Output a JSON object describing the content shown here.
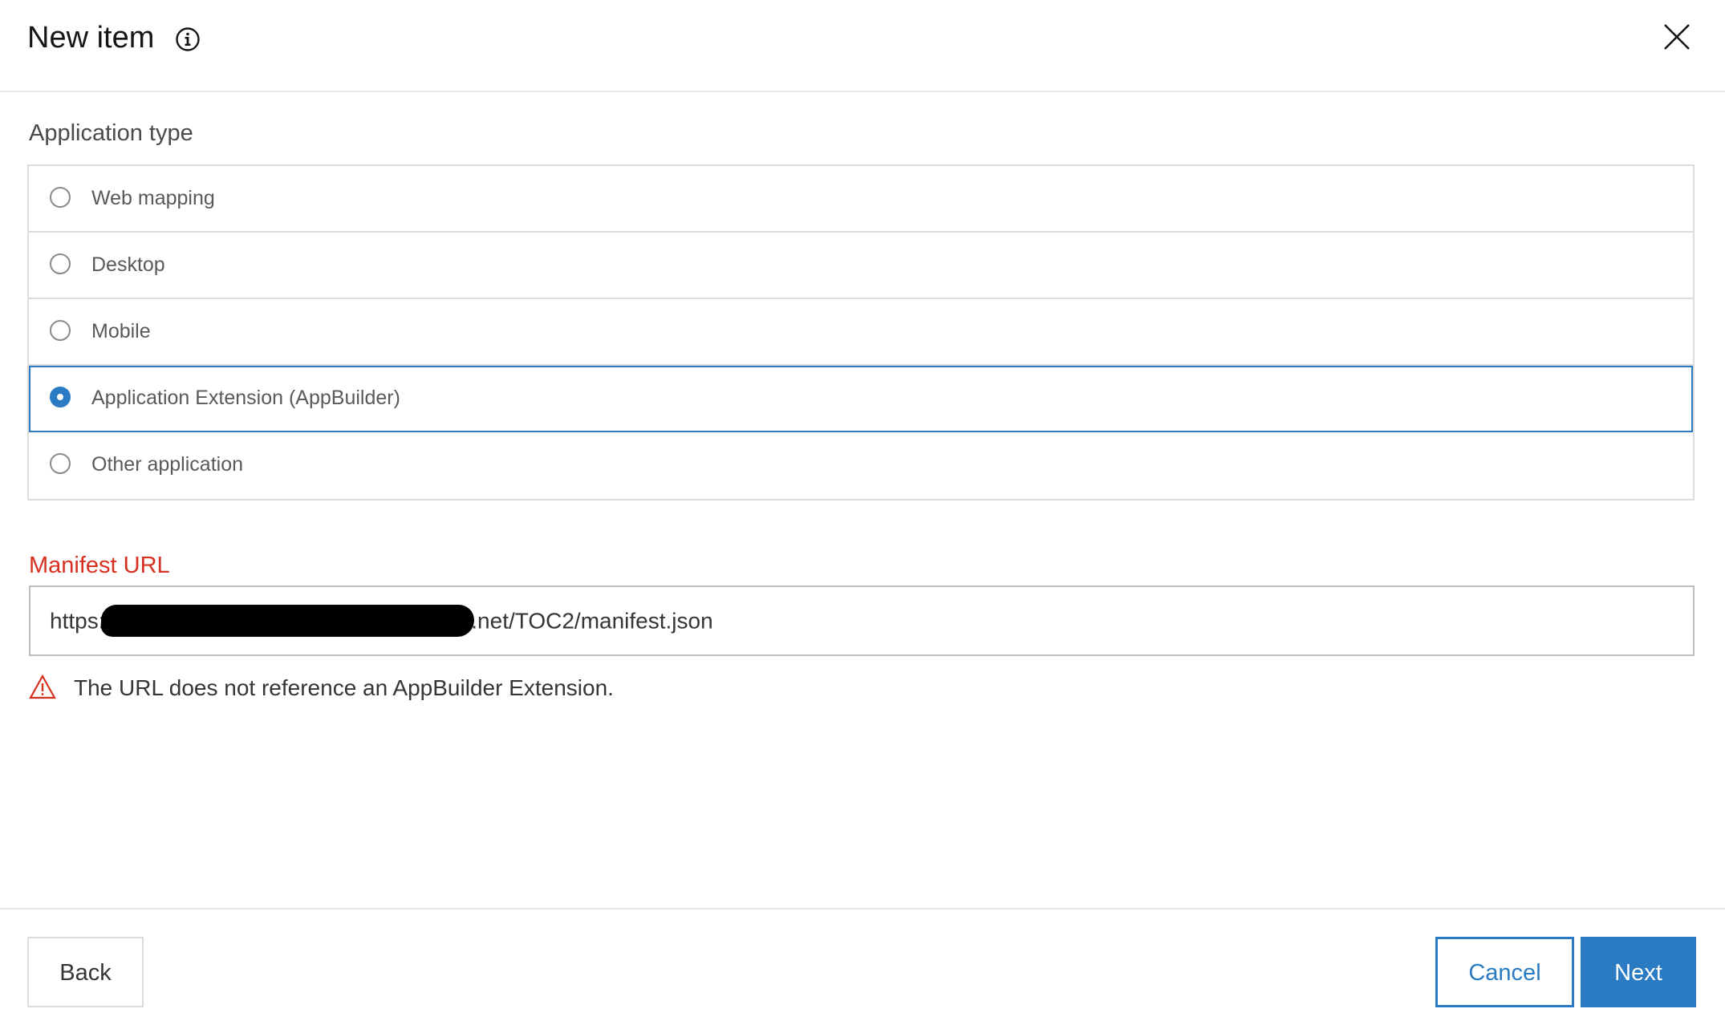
{
  "header": {
    "title": "New item",
    "info_icon": "info-circle-icon",
    "close_icon": "close-x-icon"
  },
  "application_type": {
    "label": "Application type",
    "options": [
      {
        "label": "Web mapping",
        "selected": false
      },
      {
        "label": "Desktop",
        "selected": false
      },
      {
        "label": "Mobile",
        "selected": false
      },
      {
        "label": "Application Extension (AppBuilder)",
        "selected": true
      },
      {
        "label": "Other application",
        "selected": false
      }
    ]
  },
  "manifest": {
    "label": "Manifest URL",
    "value_prefix": "https:/",
    "value_suffix": ".net/TOC2/manifest.json",
    "error_message": "The URL does not reference an AppBuilder Extension.",
    "error_icon": "warning-triangle-icon"
  },
  "footer": {
    "back_label": "Back",
    "cancel_label": "Cancel",
    "next_label": "Next"
  },
  "colors": {
    "accent": "#2a7bc3",
    "error": "#d83020",
    "border": "#dcdcdc"
  }
}
